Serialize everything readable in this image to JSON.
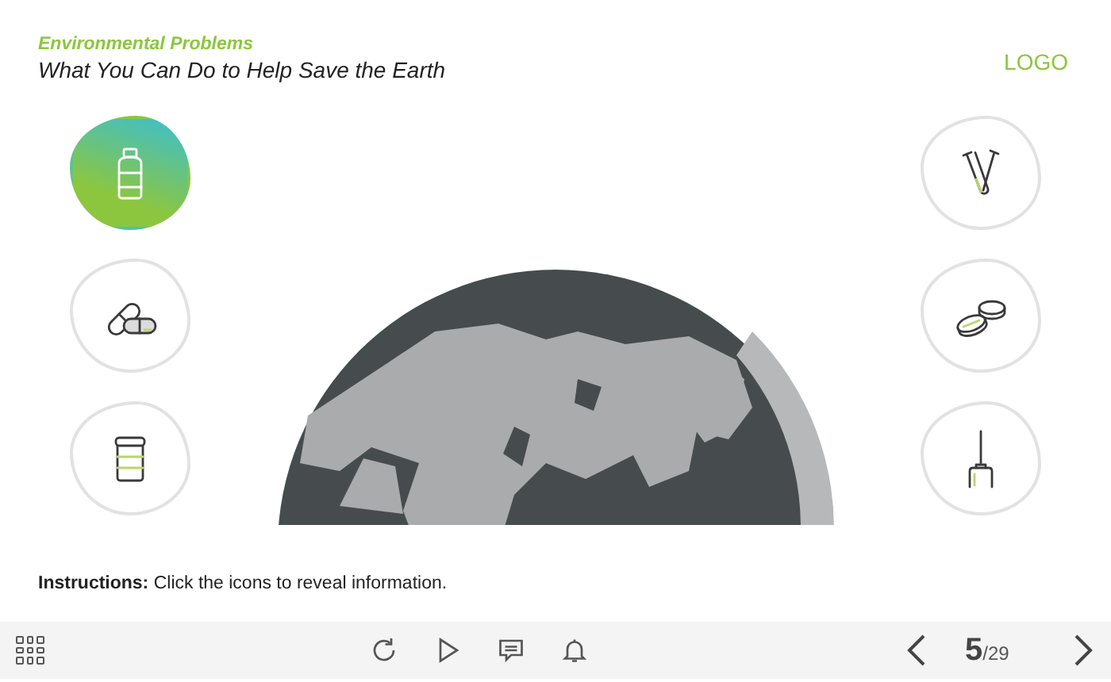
{
  "header": {
    "subtitle": "Environmental Problems",
    "title": "What You Can Do to Help Save the Earth",
    "logo": "LOGO"
  },
  "left_icons": [
    {
      "kind": "bottle",
      "selected": true
    },
    {
      "kind": "pills",
      "selected": false
    },
    {
      "kind": "jar",
      "selected": false
    }
  ],
  "right_icons": [
    {
      "kind": "test-tubes",
      "selected": false
    },
    {
      "kind": "petri-dishes",
      "selected": false
    },
    {
      "kind": "syringe",
      "selected": false
    }
  ],
  "instructions": "**Instructions:** Click the icons to reveal information.",
  "player": {
    "current": "5",
    "total": "/29"
  }
}
